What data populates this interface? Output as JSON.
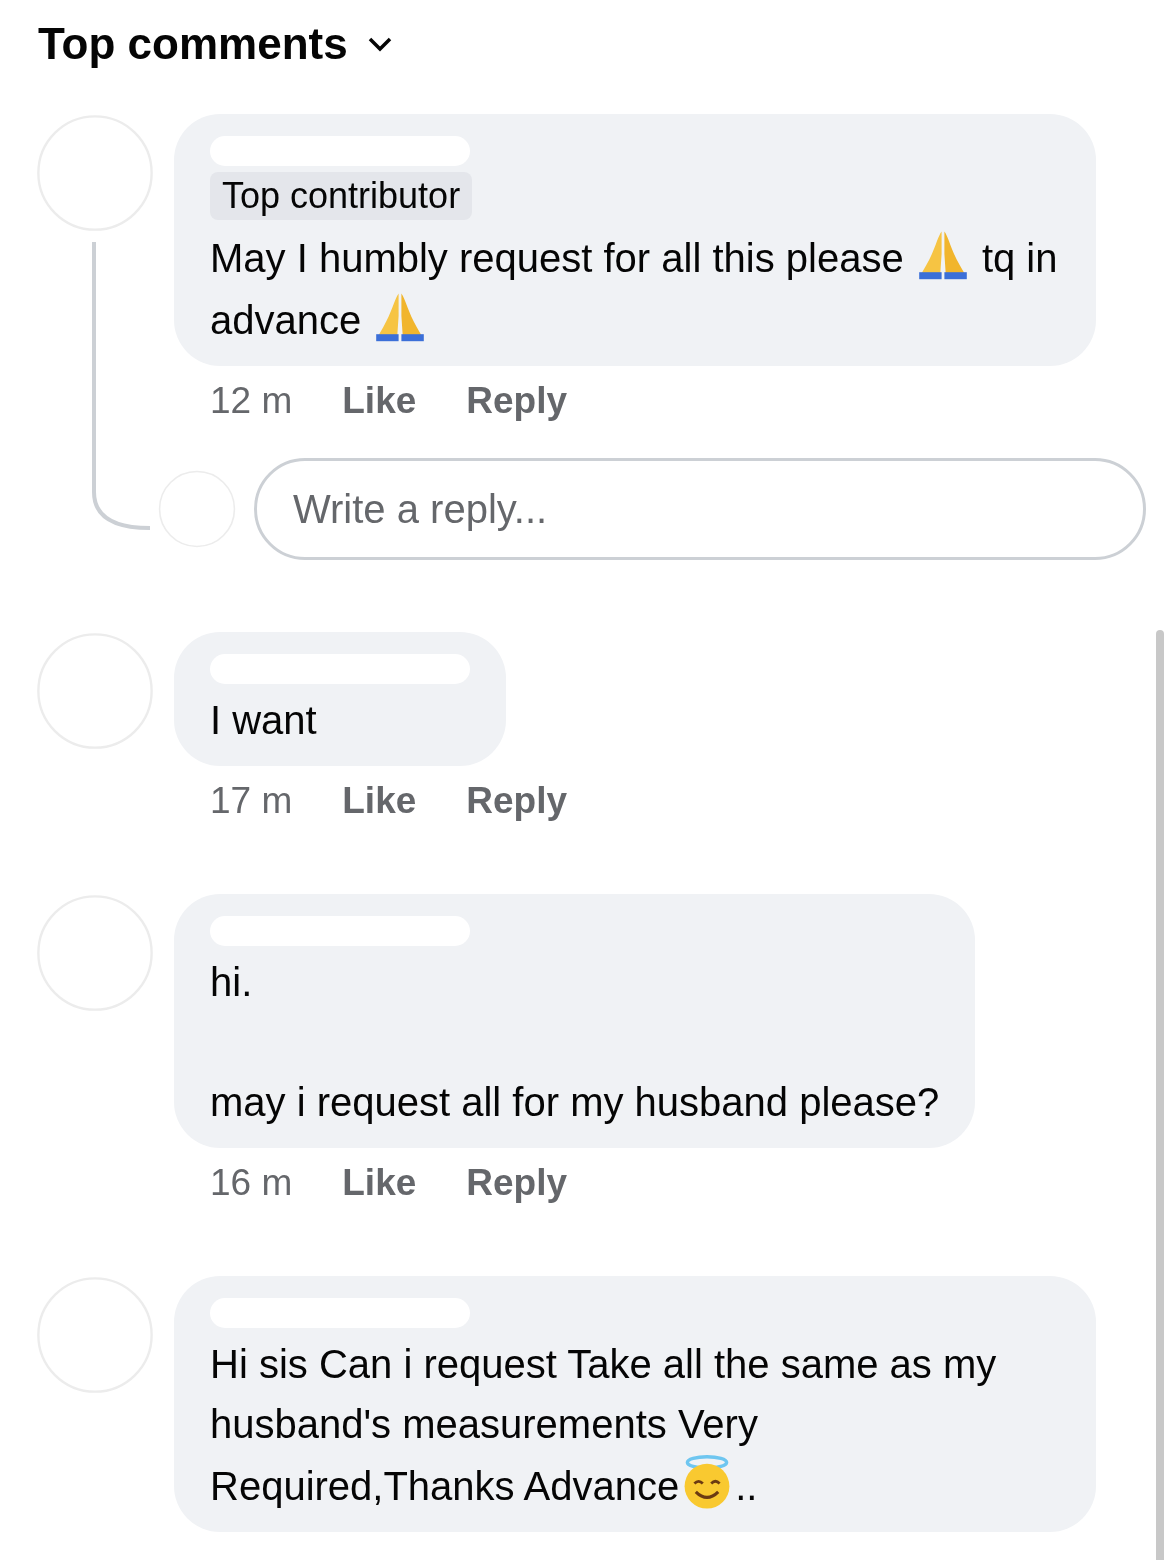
{
  "header": {
    "title": "Top comments"
  },
  "comments": [
    {
      "badge": "Top contributor",
      "body": [
        {
          "kind": "text",
          "text": "May I humbly request for all this please "
        },
        {
          "kind": "pray"
        },
        {
          "kind": "text",
          "text": " tq in advance "
        },
        {
          "kind": "pray"
        }
      ],
      "time": "12 m",
      "like": "Like",
      "reply": "Reply",
      "composer": {
        "placeholder": "Write a reply..."
      }
    },
    {
      "body": [
        {
          "kind": "text",
          "text": "I want"
        }
      ],
      "time": "17 m",
      "like": "Like",
      "reply": "Reply"
    },
    {
      "body": [
        {
          "kind": "text",
          "text": "hi.\n\nmay i request all for my husband please?"
        }
      ],
      "time": "16 m",
      "like": "Like",
      "reply": "Reply"
    },
    {
      "body": [
        {
          "kind": "text",
          "text": "Hi sis Can i request Take all the same as my husband's measurements Very Required,Thanks Advance"
        },
        {
          "kind": "halo"
        },
        {
          "kind": "text",
          "text": ".."
        }
      ]
    }
  ]
}
